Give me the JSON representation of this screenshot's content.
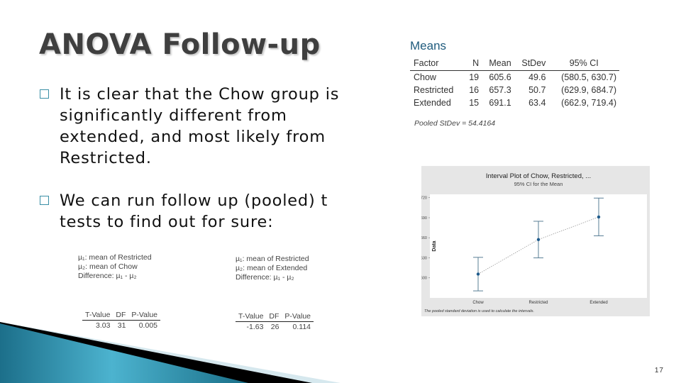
{
  "slide": {
    "title": "ANOVA Follow-up",
    "page_number": "17",
    "bullets": [
      {
        "icon": "square-bullet-icon",
        "text": "It is clear that the Chow group is significantly different from extended, and most likely from Restricted."
      },
      {
        "icon": "square-bullet-icon",
        "text": "We can run follow up (pooled) t tests to find out for sure:"
      }
    ],
    "accent_color": "#2a8aa8"
  },
  "means": {
    "title": "Means",
    "headers": [
      "Factor",
      "N",
      "Mean",
      "StDev",
      "95% CI"
    ],
    "rows": [
      [
        "Chow",
        "19",
        "605.6",
        "49.6",
        "(580.5, 630.7)"
      ],
      [
        "Restricted",
        "16",
        "657.3",
        "50.7",
        "(629.9, 684.7)"
      ],
      [
        "Extended",
        "15",
        "691.1",
        "63.4",
        "(662.9, 719.4)"
      ]
    ],
    "pooled": "Pooled StDev = 54.4164"
  },
  "ttests": [
    {
      "mu1": "µ₁: mean of Restricted",
      "mu2": "µ₂: mean of Chow",
      "difference": "Difference: µ₁ - µ₂",
      "headers": [
        "T-Value",
        "DF",
        "P-Value"
      ],
      "values": [
        "3.03",
        "31",
        "0.005"
      ]
    },
    {
      "mu1": "µ₁: mean of Restricted",
      "mu2": "µ₂: mean of Extended",
      "difference": "Difference: µ₁ - µ₂",
      "headers": [
        "T-Value",
        "DF",
        "P-Value"
      ],
      "values": [
        "-1.63",
        "26",
        "0.114"
      ]
    }
  ],
  "chart_data": {
    "type": "interval",
    "title": "Interval Plot of Chow, Restricted, ...",
    "subtitle": "95% CI for the Mean",
    "xlabel": "",
    "ylabel": "Data",
    "categories": [
      "Chow",
      "Restricted",
      "Extended"
    ],
    "means": [
      605.6,
      657.3,
      691.1
    ],
    "ci_low": [
      580.5,
      629.9,
      662.9
    ],
    "ci_high": [
      630.7,
      684.7,
      719.4
    ],
    "yticks": [
      600,
      630,
      660,
      690,
      720
    ],
    "ylim": [
      570,
      725
    ],
    "footnote": "The pooled standard deviation is used to calculate the intervals.",
    "point_color": "#1f5b8c",
    "bar_color": "#5a7f96",
    "grid": false
  }
}
